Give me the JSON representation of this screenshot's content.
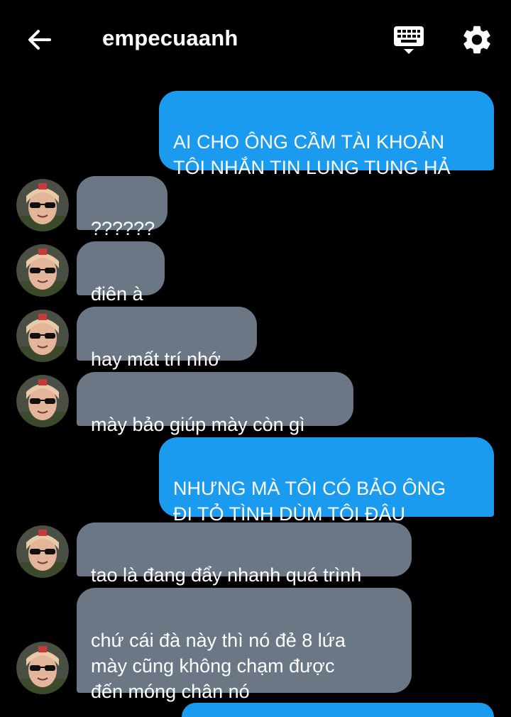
{
  "header": {
    "title": "empecuaanh",
    "back_icon": "back-arrow-icon",
    "keyboard_icon": "keyboard-icon",
    "settings_icon": "gear-icon"
  },
  "colors": {
    "background": "#000000",
    "outgoing_bubble": "#1a9bf0",
    "incoming_bubble": "#6b7785",
    "text": "#ffffff"
  },
  "messages": [
    {
      "side": "out",
      "text": "AI CHO ÔNG CẦM TÀI KHOẢN\nTÔI NHẮN TIN LUNG TUNG HẢ"
    },
    {
      "side": "in",
      "text": "??????"
    },
    {
      "side": "in",
      "text": "điên à"
    },
    {
      "side": "in",
      "text": "hay mất trí nhớ"
    },
    {
      "side": "in",
      "text": "mày bảo giúp mày còn gì"
    },
    {
      "side": "out",
      "text": "NHƯNG MÀ TÔI CÓ BẢO ÔNG\nĐI TỎ TÌNH DÙM TÔI ĐÂU"
    },
    {
      "side": "in",
      "text": "tao là đang đẩy nhanh quá trình"
    },
    {
      "side": "in",
      "text": "chứ cái đà này thì nó đẻ 8 lứa\nmày cũng không chạm được\nđến móng chân nó"
    }
  ]
}
